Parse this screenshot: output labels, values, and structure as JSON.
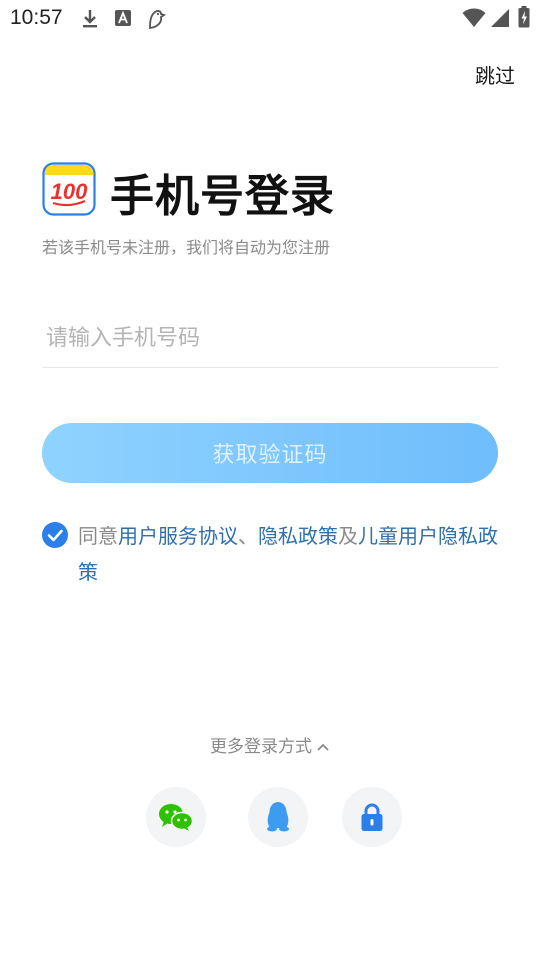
{
  "status_bar": {
    "time": "10:57"
  },
  "header": {
    "skip_label": "跳过"
  },
  "login": {
    "title": "手机号登录",
    "subtitle": "若该手机号未注册，我们将自动为您注册",
    "phone_placeholder": "请输入手机号码",
    "get_code_label": "获取验证码"
  },
  "agreement": {
    "checked": true,
    "prefix": "同意",
    "link1": "用户服务协议",
    "sep1": "、",
    "link2": "隐私政策",
    "sep2": "及",
    "link3": "儿童用户隐私政策"
  },
  "more_login": {
    "label": "更多登录方式",
    "options": [
      "wechat-icon",
      "qq-icon",
      "lock-icon"
    ]
  },
  "logo": {
    "text": "100"
  },
  "colors": {
    "accent": "#2b7fe9",
    "link": "#2e6fae",
    "button_start": "#8fd3ff",
    "button_end": "#6fbdfc",
    "wechat": "#2dc100",
    "qq": "#3d9cf0"
  }
}
